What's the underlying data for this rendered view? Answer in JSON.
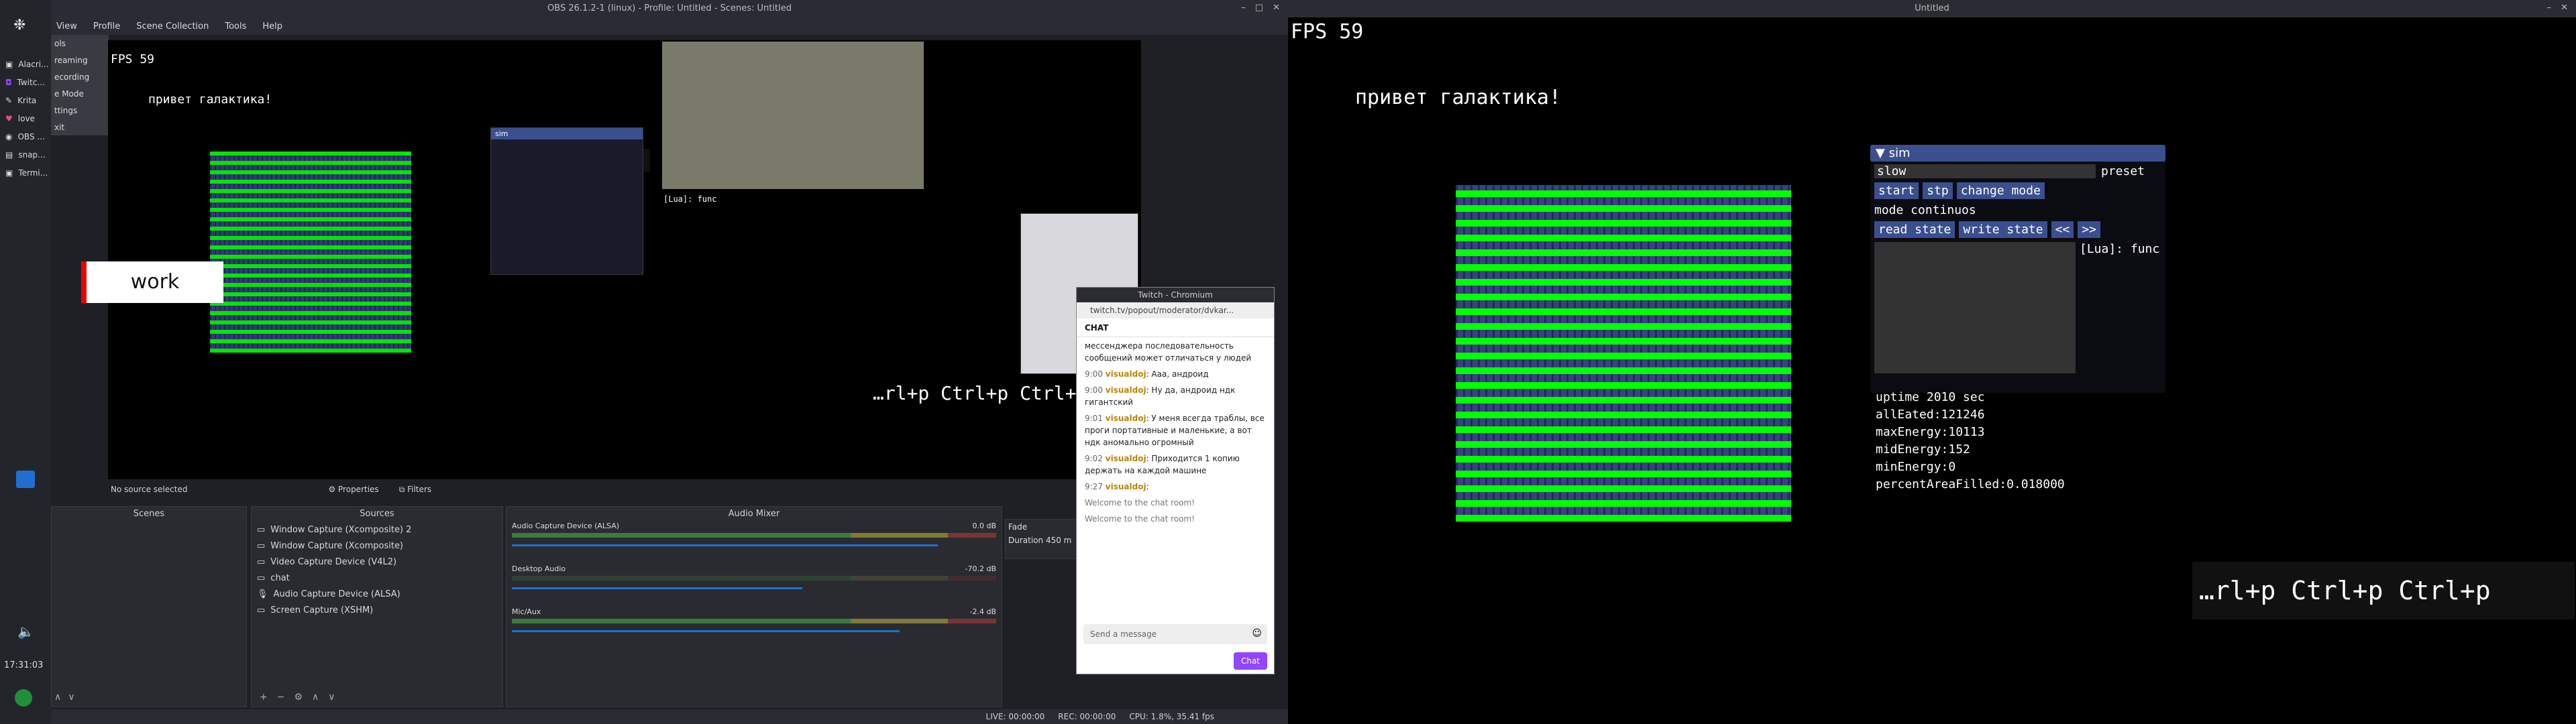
{
  "obs": {
    "title": "OBS 26.1.2-1 (linux) - Profile: Untitled - Scenes: Untitled",
    "menu": [
      "View",
      "Profile",
      "Scene Collection",
      "Tools",
      "Help"
    ],
    "left_menu": [
      "Alacri...",
      "Twitc...",
      "Krita",
      "love",
      "OBS ...",
      "snap...",
      "Termi..."
    ],
    "ctrl_labels": [
      "ols",
      "reaming",
      "ecording",
      "e Mode",
      "ttings",
      "xit"
    ],
    "no_source": "No source selected",
    "properties": "Properties",
    "filters": "Filters",
    "scenes_label": "Scenes",
    "sources_label": "Sources",
    "mixer_label": "Audio Mixer",
    "sources": [
      "Window Capture (Xcomposite) 2",
      "Window Capture (Xcomposite)",
      "Video Capture Device (V4L2)",
      "chat",
      "Audio Capture Device (ALSA)",
      "Screen Capture (XSHM)"
    ],
    "mixer": [
      {
        "name": "Audio Capture Device (ALSA)",
        "db": "0.0 dB"
      },
      {
        "name": "Desktop Audio",
        "db": "-70.2 dB"
      },
      {
        "name": "Mic/Aux",
        "db": "-2.4 dB"
      }
    ],
    "fade_label": "Fade",
    "duration_label": "Duration",
    "duration_value": "450 m",
    "status": {
      "live": "LIVE: 00:00:00",
      "rec": "REC: 00:00:00",
      "cpu": "CPU: 1.8%, 35.41 fps"
    },
    "clock": "17:31:03"
  },
  "preview": {
    "fps": "FPS 59",
    "greeting": "привет галактика!",
    "work": "work",
    "shortcut": "…rl+p Ctrl+p Ctrl+p",
    "lua": "[Lua]: func"
  },
  "chat": {
    "window_title": "Twitch - Chromium",
    "url": "twitch.tv/popout/moderator/dvkar...",
    "header": "CHAT",
    "messages": [
      {
        "time": "",
        "user": "",
        "text": "мессенджера последовательность сообщений может отличаться у людей"
      },
      {
        "time": "9:00",
        "user": "visualdoj",
        "text": "Ааа, андроид"
      },
      {
        "time": "9:00",
        "user": "visualdoj",
        "text": "Ну да, андроид ндк гигантский"
      },
      {
        "time": "9:01",
        "user": "visualdoj",
        "text": "У меня всегда траблы, все проги портативные и маленькие, а вот ндк аномально огромный"
      },
      {
        "time": "9:02",
        "user": "visualdoj",
        "text": "Приходится 1 копию держать на каждой машине"
      },
      {
        "time": "9:27",
        "user": "visualdoj",
        "text": ""
      }
    ],
    "welcome": "Welcome to the chat room!",
    "placeholder": "Send a message",
    "chat_button": "Chat"
  },
  "sim": {
    "window_title": "Untitled",
    "fps": "FPS 59",
    "greeting": "привет галактика!",
    "panel_title": "sim",
    "speed": "slow",
    "preset": "preset",
    "buttons1": [
      "start",
      "stp",
      "change mode"
    ],
    "mode": "mode continuos",
    "buttons2": [
      "read state",
      "write state",
      "<<",
      ">>"
    ],
    "lua": "[Lua]: func",
    "stats": [
      "uptime 2010 sec",
      "allEated:121246",
      "maxEnergy:10113",
      "midEnergy:152",
      "minEnergy:0",
      "percentAreaFilled:0.018000"
    ],
    "shortcut": "…rl+p Ctrl+p Ctrl+p"
  },
  "colors": {
    "green": "#00ff00",
    "grid": "#3a3f86",
    "panel_blue": "#3b4f8f"
  }
}
